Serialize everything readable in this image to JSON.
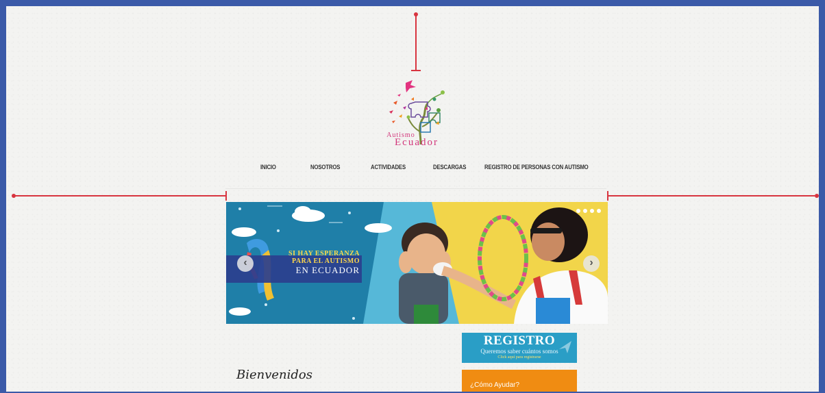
{
  "logo": {
    "line1": "Autismo",
    "line2": "Ecuador"
  },
  "nav": {
    "items": [
      {
        "label": "INICIO"
      },
      {
        "label": "NOSOTROS"
      },
      {
        "label": "ACTIVIDADES"
      },
      {
        "label": "DESCARGAS"
      },
      {
        "label": "REGISTRO DE PERSONAS CON AUTISMO"
      }
    ]
  },
  "slider": {
    "line1": "SI HAY ESPERANZA",
    "line2": "PARA EL AUTISMO",
    "line3": "EN ECUADOR",
    "prev_icon": "chevron-left-icon",
    "next_icon": "chevron-right-icon",
    "dots": 4,
    "active_dot": 1
  },
  "registro": {
    "title": "REGISTRO",
    "subtitle": "Queremos saber cuántos somos",
    "link": "Click aquí para registrarse"
  },
  "ayudar": {
    "label": "¿Cómo Ayudar?"
  },
  "main": {
    "welcome": "Bienvenidos"
  },
  "colors": {
    "frame": "#3b5aa8",
    "guide": "#d8343f",
    "logo_pink": "#d2367b",
    "registro_bg": "#2a9ec6",
    "ayudar_bg": "#f08c12",
    "banner_blue": "#1f7fa8"
  }
}
